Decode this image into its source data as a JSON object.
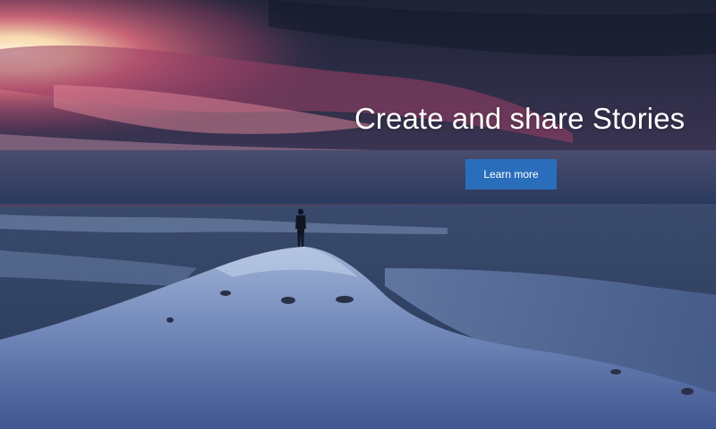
{
  "hero": {
    "headline": "Create and share Stories",
    "cta_label": "Learn more",
    "background_image": "sunset-over-snowy-mountain-with-lone-hiker"
  },
  "colors": {
    "button": "#2a6ebb",
    "text": "#ffffff"
  }
}
